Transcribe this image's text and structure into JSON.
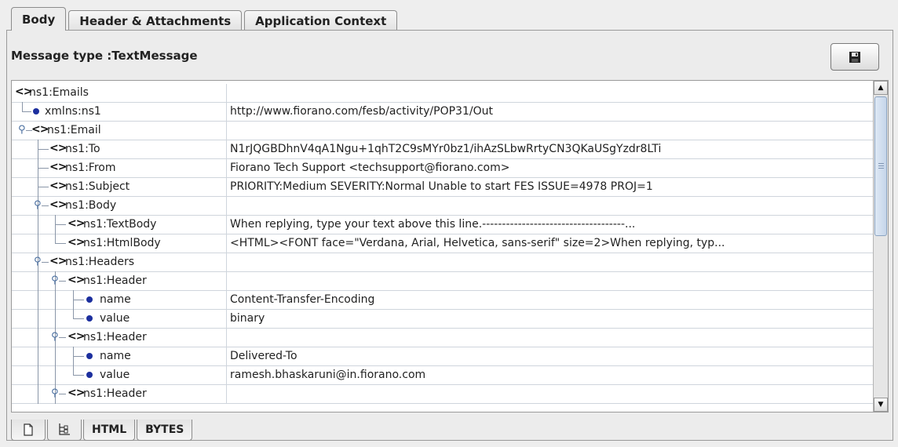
{
  "tabs": {
    "body": "Body",
    "header": "Header & Attachments",
    "context": "Application Context"
  },
  "message_type": "Message type :TextMessage",
  "save_icon": "floppy-disk-icon",
  "tree": [
    {
      "name": "ns1:Emails",
      "kind": "element",
      "value": ""
    },
    {
      "name": "xmlns:ns1",
      "kind": "attribute",
      "value": "http://www.fiorano.com/fesb/activity/POP31/Out"
    },
    {
      "name": "ns1:Email",
      "kind": "element",
      "value": ""
    },
    {
      "name": "ns1:To",
      "kind": "element",
      "value": "N1rJQGBDhnV4qA1Ngu+1qhT2C9sMYr0bz1/ihAzSLbwRrtyCN3QKaUSgYzdr8LTi"
    },
    {
      "name": "ns1:From",
      "kind": "element",
      "value": "Fiorano Tech Support <techsupport@fiorano.com>"
    },
    {
      "name": "ns1:Subject",
      "kind": "element",
      "value": "PRIORITY:Medium SEVERITY:Normal Unable to start FES ISSUE=4978 PROJ=1"
    },
    {
      "name": "ns1:Body",
      "kind": "element",
      "value": ""
    },
    {
      "name": "ns1:TextBody",
      "kind": "element",
      "value": "When replying, type your text above this line.------------------------------------..."
    },
    {
      "name": "ns1:HtmlBody",
      "kind": "element",
      "value": "<HTML><FONT face=\"Verdana, Arial, Helvetica, sans-serif\" size=2>When replying, typ..."
    },
    {
      "name": "ns1:Headers",
      "kind": "element",
      "value": ""
    },
    {
      "name": "ns1:Header",
      "kind": "element",
      "value": ""
    },
    {
      "name": "name",
      "kind": "attribute",
      "value": "Content-Transfer-Encoding"
    },
    {
      "name": "value",
      "kind": "attribute",
      "value": "binary"
    },
    {
      "name": "ns1:Header",
      "kind": "element",
      "value": ""
    },
    {
      "name": "name",
      "kind": "attribute",
      "value": "Delivered-To"
    },
    {
      "name": "value",
      "kind": "attribute",
      "value": "ramesh.bhaskaruni@in.fiorano.com"
    },
    {
      "name": "ns1:Header",
      "kind": "element",
      "value": ""
    }
  ],
  "bottom_tabs": {
    "text_icon": "document-icon",
    "tree_icon": "tree-view-icon",
    "html": "HTML",
    "bytes": "BYTES"
  },
  "colors": {
    "panel_bg": "#eeeeee",
    "grid_line": "#cfd5dc",
    "attribute_dot": "#1c2f9e"
  }
}
